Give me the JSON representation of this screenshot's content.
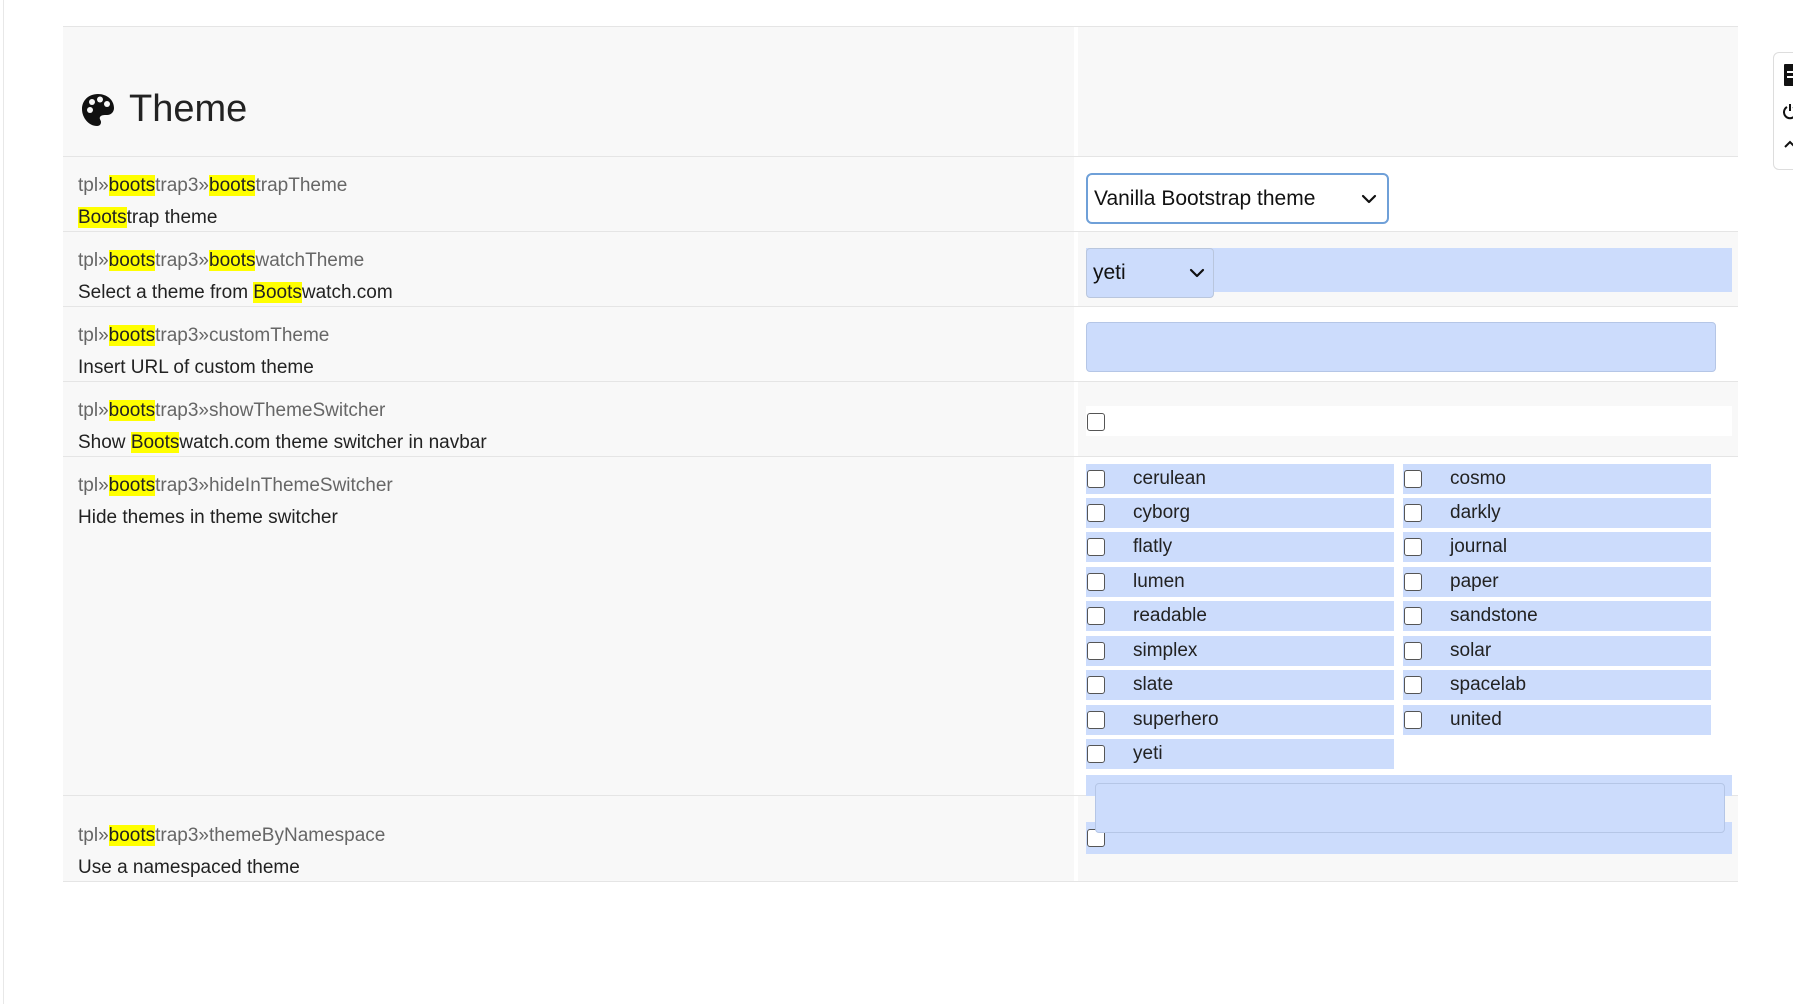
{
  "section": {
    "title": "Theme",
    "icon": "palette-icon"
  },
  "colors": {
    "highlight": "#ffff00",
    "field_blue": "#ccdcfc",
    "row_gray": "#f8f8f8"
  },
  "settings": [
    {
      "key_parts": [
        "tpl»",
        "boots",
        "trap3»",
        "boots",
        "trapTheme"
      ],
      "desc_parts": [
        "Boots",
        "trap theme"
      ],
      "control": {
        "type": "select",
        "value": "Vanilla Bootstrap theme"
      }
    },
    {
      "key_parts": [
        "tpl»",
        "boots",
        "trap3»",
        "boots",
        "watchTheme"
      ],
      "desc_parts": [
        "Select a theme from ",
        "Boots",
        "watch.com"
      ],
      "control": {
        "type": "select",
        "value": "yeti"
      }
    },
    {
      "key_parts": [
        "tpl»",
        "boots",
        "trap3»customTheme"
      ],
      "desc_parts": [
        "Insert URL of custom theme"
      ],
      "control": {
        "type": "text",
        "value": ""
      }
    },
    {
      "key_parts": [
        "tpl»",
        "boots",
        "trap3»showThemeSwitcher"
      ],
      "desc_parts": [
        "Show ",
        "Boots",
        "watch.com theme switcher in navbar"
      ],
      "control": {
        "type": "checkbox",
        "checked": false
      }
    },
    {
      "key_parts": [
        "tpl»",
        "boots",
        "trap3»hideInThemeSwitcher"
      ],
      "desc_parts": [
        "Hide themes in theme switcher"
      ],
      "control": {
        "type": "checkbox-list",
        "options": [
          "cerulean",
          "cosmo",
          "cyborg",
          "darkly",
          "flatly",
          "journal",
          "lumen",
          "paper",
          "readable",
          "sandstone",
          "simplex",
          "solar",
          "slate",
          "spacelab",
          "superhero",
          "united",
          "yeti"
        ],
        "extra_value": ""
      }
    },
    {
      "key_parts": [
        "tpl»",
        "boots",
        "trap3»themeByNamespace"
      ],
      "desc_parts": [
        "Use a namespaced theme"
      ],
      "control": {
        "type": "checkbox",
        "checked": false
      }
    }
  ]
}
